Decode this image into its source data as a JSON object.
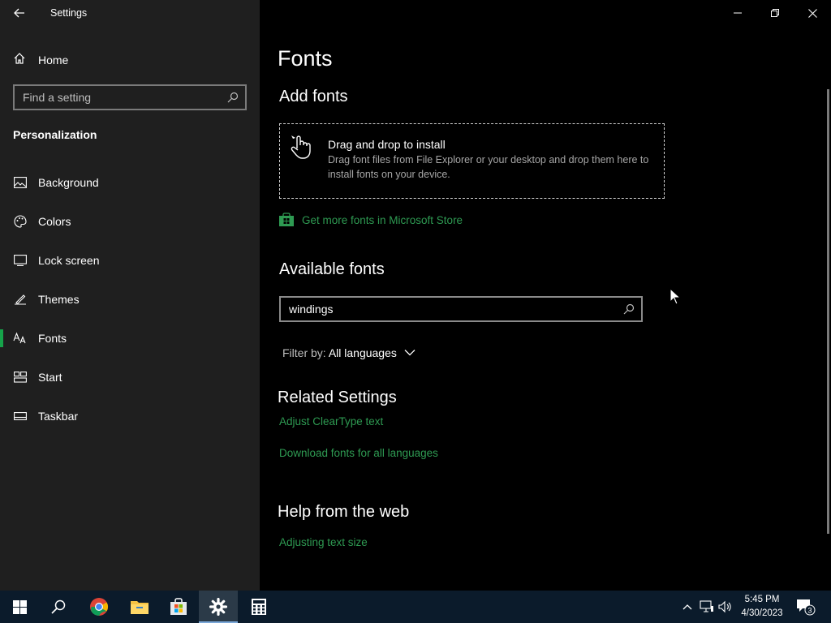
{
  "window": {
    "title": "Settings"
  },
  "sidebar": {
    "home_label": "Home",
    "search_placeholder": "Find a setting",
    "section_title": "Personalization",
    "items": [
      {
        "label": "Background",
        "icon": "background-icon"
      },
      {
        "label": "Colors",
        "icon": "palette-icon"
      },
      {
        "label": "Lock screen",
        "icon": "lock-screen-icon"
      },
      {
        "label": "Themes",
        "icon": "themes-icon"
      },
      {
        "label": "Fonts",
        "icon": "fonts-icon",
        "active": true
      },
      {
        "label": "Start",
        "icon": "start-icon"
      },
      {
        "label": "Taskbar",
        "icon": "taskbar-icon"
      }
    ]
  },
  "main": {
    "page_title": "Fonts",
    "add_fonts": {
      "heading": "Add fonts",
      "dropzone_title": "Drag and drop to install",
      "dropzone_desc": "Drag font files from File Explorer or your desktop and drop them here to install fonts on your device.",
      "store_link": "Get more fonts in Microsoft Store"
    },
    "available_fonts": {
      "heading": "Available fonts",
      "search_value": "windings",
      "filter_label": "Filter by:",
      "filter_value": "All languages"
    },
    "related": {
      "heading": "Related Settings",
      "links": [
        "Adjust ClearType text",
        "Download fonts for all languages"
      ]
    },
    "help": {
      "heading": "Help from the web",
      "links": [
        "Adjusting text size"
      ]
    }
  },
  "taskbar": {
    "time": "5:45 PM",
    "date": "4/30/2023",
    "notification_count": "3",
    "apps": [
      "start-icon",
      "search-icon",
      "chrome-icon",
      "file-explorer-icon",
      "microsoft-store-icon",
      "settings-icon",
      "calculator-icon"
    ]
  },
  "colors": {
    "accent": "#16a34a",
    "link": "#2e9a52",
    "sidebar_bg": "#1f1f1f",
    "main_bg": "#000000",
    "taskbar_bg": "#0b1b2b"
  }
}
